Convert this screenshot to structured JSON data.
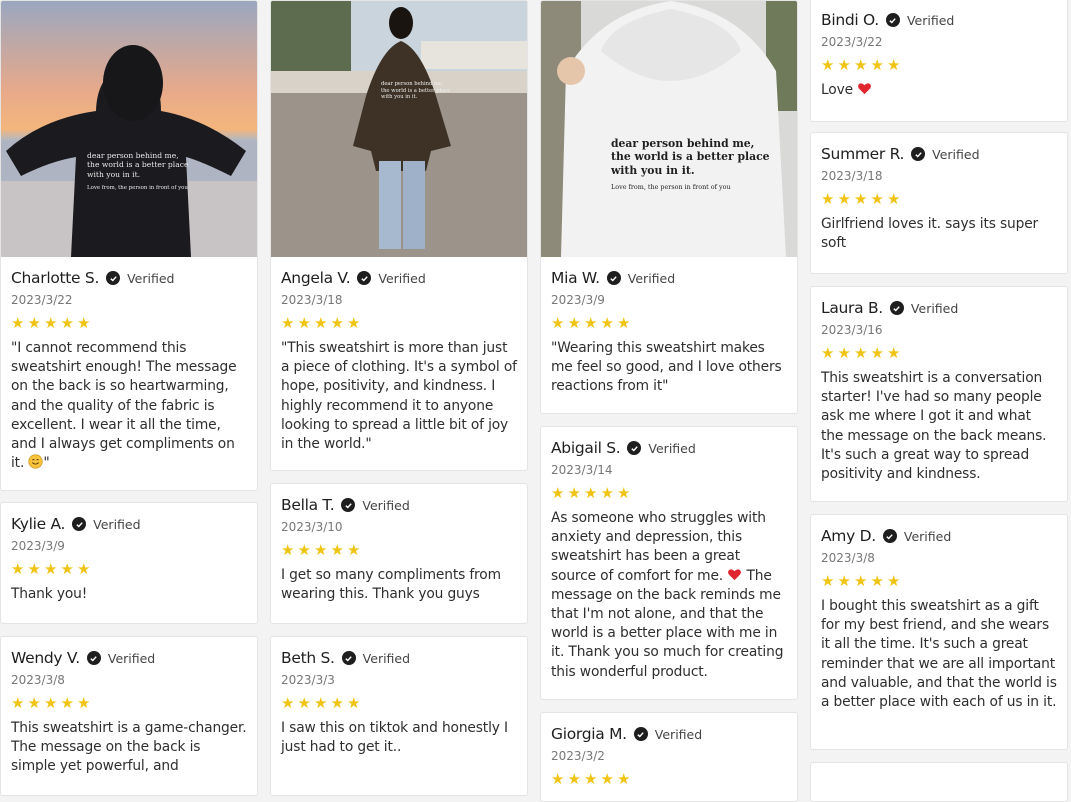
{
  "verified_label": "Verified",
  "colors": {
    "star": "#f0c415",
    "heart": "#e0262e"
  },
  "reviews": {
    "charlotte": {
      "name": "Charlotte S.",
      "date": "2023/3/22",
      "rating": 5,
      "text": "\"I cannot recommend this sweatshirt enough! The message on the back is so heartwarming, and the quality of the fabric is excellent. I wear it all the time, and I always get compliments on it. ",
      "text_end": "\""
    },
    "kylie": {
      "name": "Kylie A.",
      "date": "2023/3/9",
      "rating": 5,
      "text": "Thank you!"
    },
    "wendy": {
      "name": "Wendy V.",
      "date": "2023/3/8",
      "rating": 5,
      "text": "This sweatshirt is a game-changer. The message on the back is simple yet powerful, and"
    },
    "angela": {
      "name": "Angela V.",
      "date": "2023/3/18",
      "rating": 5,
      "text": "\"This sweatshirt is more than just a piece of clothing. It's a symbol of hope, positivity, and kindness. I highly recommend it to anyone looking to spread a little bit of joy in the world.\""
    },
    "bella": {
      "name": "Bella T.",
      "date": "2023/3/10",
      "rating": 5,
      "text": "I get so many compliments from wearing this. Thank you guys"
    },
    "beth": {
      "name": "Beth S.",
      "date": "2023/3/3",
      "rating": 5,
      "text": "I saw this on tiktok and honestly I just had to get it.."
    },
    "mia": {
      "name": "Mia W.",
      "date": "2023/3/9",
      "rating": 5,
      "text": "\"Wearing this sweatshirt makes me feel so good, and I love others reactions from it\""
    },
    "abigail": {
      "name": "Abigail S.",
      "date": "2023/3/14",
      "rating": 5,
      "text": "As someone who struggles with anxiety and depression, this sweatshirt has been a great source of comfort for me. ",
      "text_end": " The message on the back reminds me that I'm not alone, and that the world is a better place with me in it. Thank you so much for creating this wonderful product."
    },
    "giorgia": {
      "name": "Giorgia M.",
      "date": "2023/3/2",
      "rating": 5
    },
    "bindi": {
      "name": "Bindi O.",
      "date": "2023/3/22",
      "rating": 5,
      "text": "Love "
    },
    "summer": {
      "name": "Summer R.",
      "date": "2023/3/18",
      "rating": 5,
      "text": "Girlfriend loves it. says its super soft"
    },
    "laura": {
      "name": "Laura B.",
      "date": "2023/3/16",
      "rating": 5,
      "text": "This sweatshirt is a conversation starter! I've had so many people ask me where I got it and what the message on the back means. It's such a great way to spread positivity and kindness."
    },
    "amy": {
      "name": "Amy D.",
      "date": "2023/3/8",
      "rating": 5,
      "text": "I bought this sweatshirt as a gift for my best friend, and she wears it all the time. It's such a great reminder that we are all important and valuable, and that the world is a better place with each of us in it."
    }
  },
  "hoodie_print": {
    "line1": "dear person behind me,",
    "line2": "the world is a better place",
    "line3": "with you in it.",
    "signoff": "Love from, the person in front of you"
  }
}
